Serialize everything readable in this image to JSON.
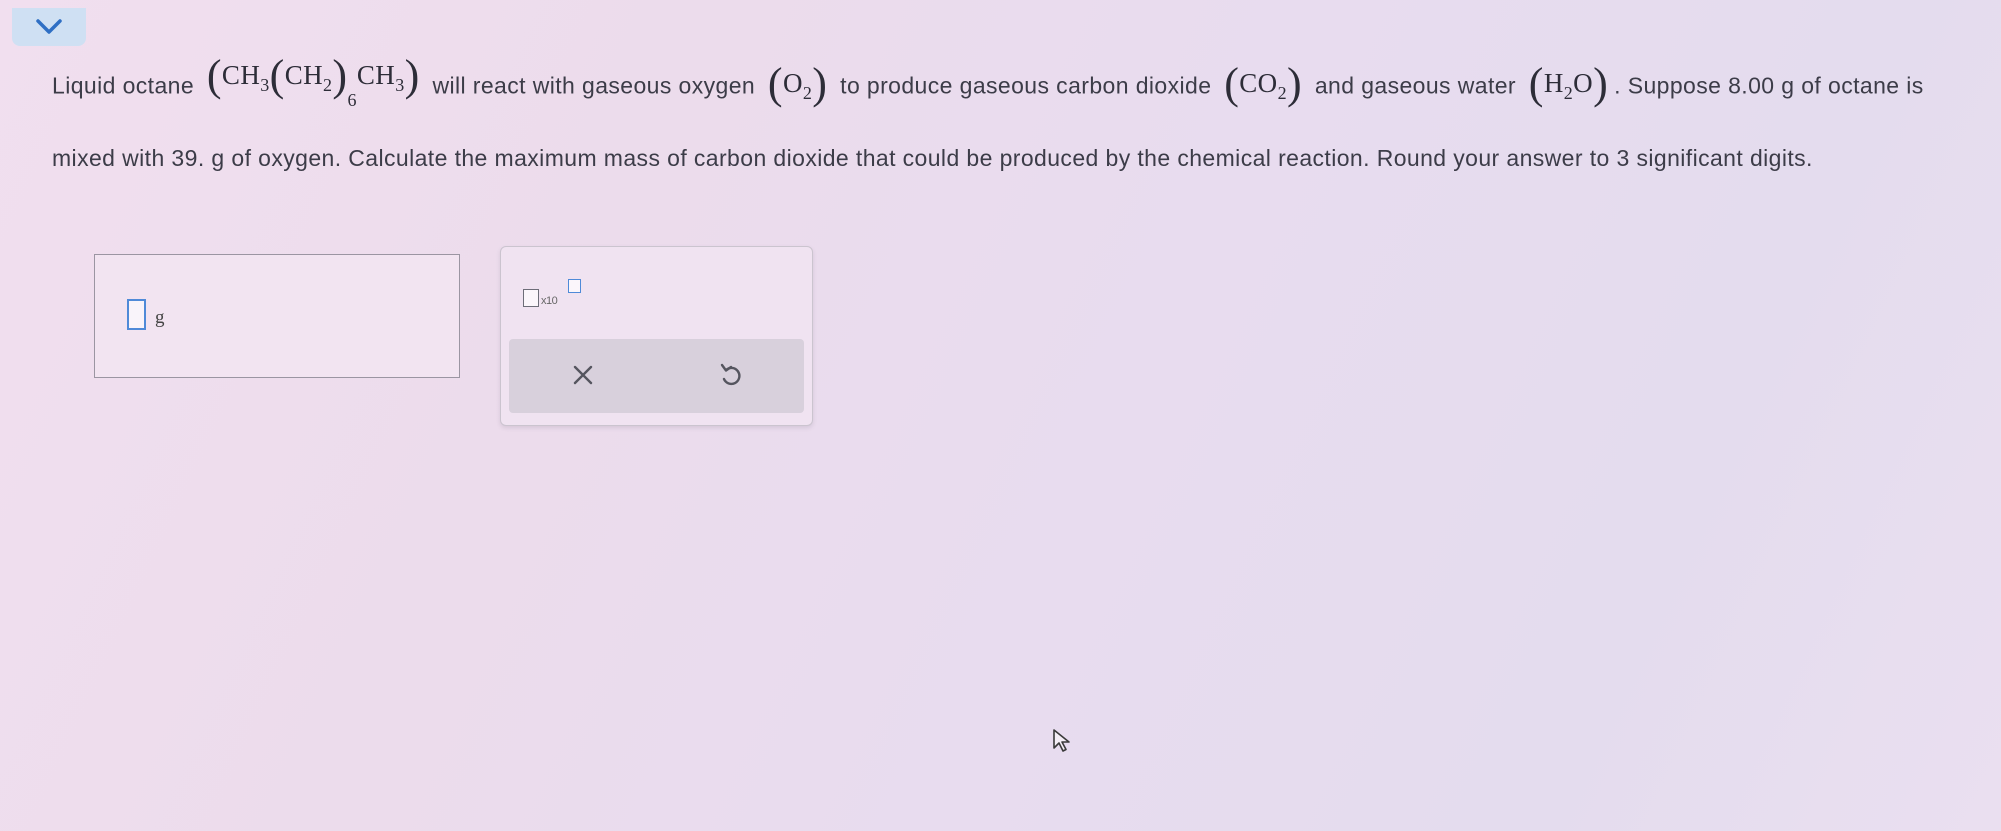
{
  "question": {
    "t1": "Liquid octane",
    "octane_formula": {
      "p1": "CH",
      "s1": "3",
      "p2": "CH",
      "s2": "2",
      "mult": "6",
      "p3": "CH",
      "s3": "3"
    },
    "t2": "will react with gaseous oxygen",
    "oxygen_formula": {
      "p": "O",
      "s": "2"
    },
    "t3": "to produce gaseous carbon dioxide",
    "co2_formula": {
      "p": "CO",
      "s": "2"
    },
    "t4": "and gaseous water",
    "water_formula": {
      "p1": "H",
      "s": "2",
      "p2": "O"
    },
    "t5": ". Suppose 8.00 g of octane is mixed with 39. g of oxygen. Calculate the maximum mass of carbon dioxide that could be produced by the chemical reaction. Round your answer to 3 significant digits."
  },
  "answer": {
    "value": "",
    "unit": "g"
  },
  "tools": {
    "sci_notation_label": "x10",
    "clear_icon": "close-icon",
    "undo_icon": "undo-icon"
  },
  "icons": {
    "collapse": "chevron-down-icon",
    "pointer": "mouse-pointer-icon"
  },
  "colors": {
    "accent": "#4f8ad8",
    "collapse_bg": "#cfe0f3",
    "action_bar": "#d8d0dc"
  }
}
